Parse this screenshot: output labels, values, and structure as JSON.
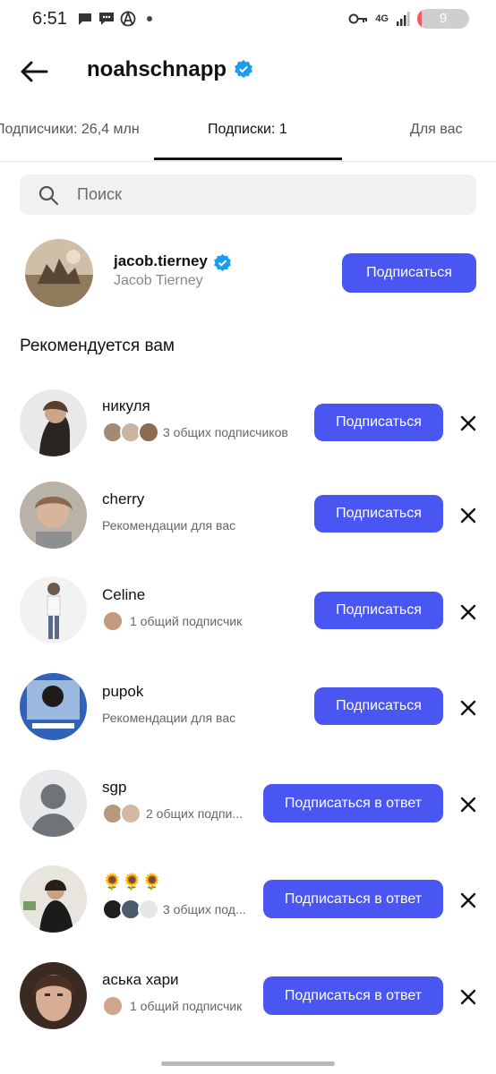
{
  "status_bar": {
    "time": "6:51",
    "network": "4G",
    "battery": "9"
  },
  "header": {
    "username": "noahschnapp"
  },
  "tabs": [
    {
      "label": "Подписчики: 26,4 млн"
    },
    {
      "label": "Подписки: 1"
    },
    {
      "label": "Для вас"
    }
  ],
  "search": {
    "placeholder": "Поиск"
  },
  "following": {
    "username": "jacob.tierney",
    "display_name": "Jacob Tierney",
    "button": "Подписаться"
  },
  "section_title": "Рекомендуется вам",
  "recommended": [
    {
      "name": "никуля",
      "subtitle": "3 общих подписчиков",
      "button": "Подписаться"
    },
    {
      "name": "cherry",
      "subtitle": "Рекомендации для вас",
      "button": "Подписаться"
    },
    {
      "name": "Celine",
      "subtitle": "1 общий подписчик",
      "button": "Подписаться"
    },
    {
      "name": "pupok",
      "subtitle": "Рекомендации для вас",
      "button": "Подписаться"
    },
    {
      "name": "sgp",
      "subtitle": "2 общих подпи...",
      "button": "Подписаться в ответ"
    },
    {
      "name": "🌻🌻🌻",
      "subtitle": "3 общих под...",
      "button": "Подписаться в ответ"
    },
    {
      "name": "аська хари",
      "subtitle": "1 общий подписчик",
      "button": "Подписаться в ответ"
    }
  ],
  "colors": {
    "accent": "#4a56f2",
    "verified": "#1d9bf0"
  }
}
